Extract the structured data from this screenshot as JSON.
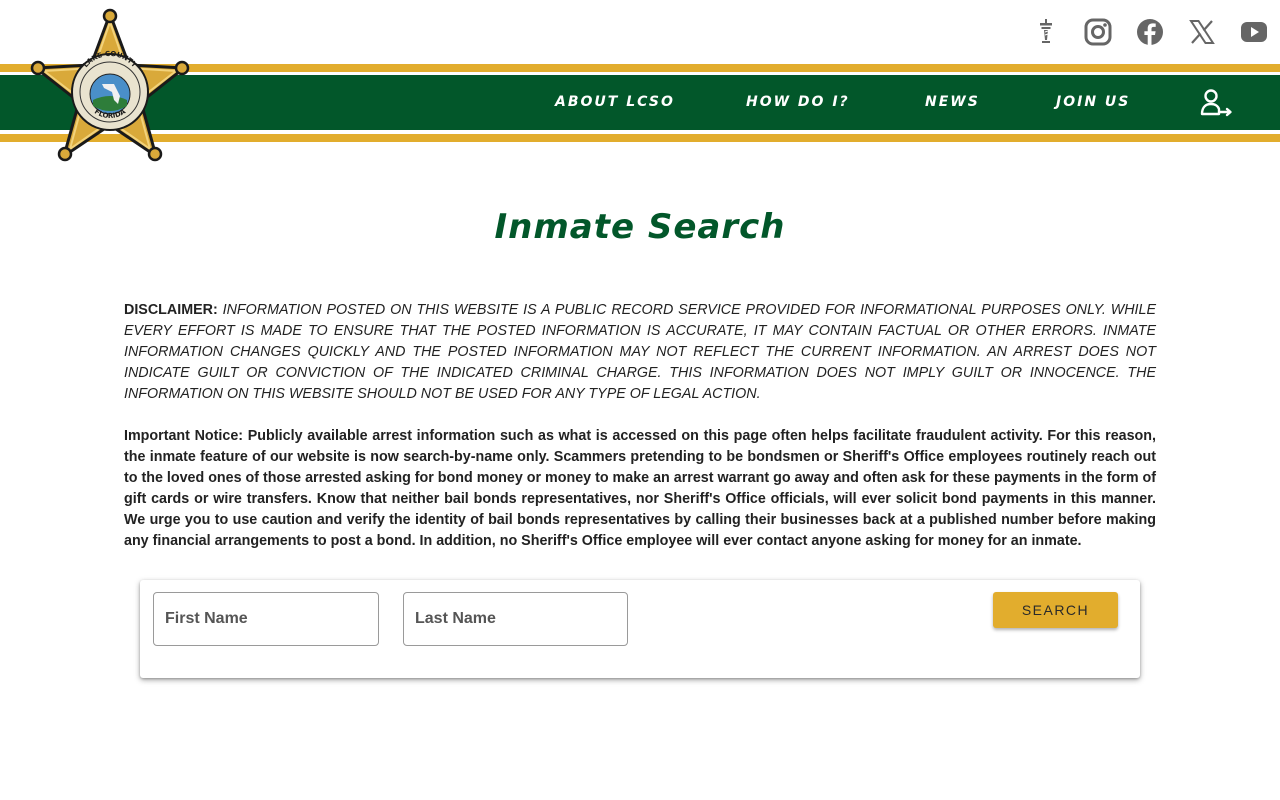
{
  "header": {
    "social": [
      {
        "name": "lighthouse-icon"
      },
      {
        "name": "instagram-icon"
      },
      {
        "name": "facebook-icon"
      },
      {
        "name": "x-twitter-icon"
      },
      {
        "name": "youtube-icon"
      }
    ],
    "nav": [
      {
        "label": "ABOUT LCSO"
      },
      {
        "label": "HOW DO I?"
      },
      {
        "label": "NEWS"
      },
      {
        "label": "JOIN US"
      }
    ],
    "badge": {
      "top_text": "OFFICE OF THE SHERIFF",
      "middle_text": "LAKE COUNTY",
      "bottom_text": "FLORIDA"
    }
  },
  "colors": {
    "green": "#02572a",
    "gold": "#e2ad2d"
  },
  "main": {
    "title": "Inmate Search",
    "disclaimer_label": "DISCLAIMER:",
    "disclaimer_text": "INFORMATION POSTED ON THIS WEBSITE IS A PUBLIC RECORD SERVICE PROVIDED FOR INFORMATIONAL PURPOSES ONLY. WHILE EVERY EFFORT IS MADE TO ENSURE THAT THE POSTED INFORMATION IS ACCURATE, IT MAY CONTAIN FACTUAL OR OTHER ERRORS. INMATE INFORMATION CHANGES QUICKLY AND THE POSTED INFORMATION MAY NOT REFLECT THE CURRENT INFORMATION. AN ARREST DOES NOT INDICATE GUILT OR CONVICTION OF THE INDICATED CRIMINAL CHARGE. THIS INFORMATION DOES NOT IMPLY GUILT OR INNOCENCE. THE INFORMATION ON THIS WEBSITE SHOULD NOT BE USED FOR ANY TYPE OF LEGAL ACTION.",
    "notice_text": "Important Notice: Publicly available arrest information such as what is accessed on this page often helps facilitate fraudulent activity. For this reason, the inmate feature of our website is now search-by-name only. Scammers pretending to be bondsmen or Sheriff's Office employees routinely reach out to the loved ones of those arrested asking for bond money or money to make an arrest warrant go away and often ask for these payments in the form of gift cards or wire transfers. Know that neither bail bonds representatives, nor Sheriff's Office officials, will ever solicit bond payments in this manner. We urge you to use caution and verify the identity of bail bonds representatives by calling their businesses back at a published number before making any financial arrangements to post a bond. In addition, no Sheriff's Office employee will ever contact anyone asking for money for an inmate."
  },
  "search": {
    "first_name_placeholder": "First Name",
    "first_name_value": "",
    "last_name_placeholder": "Last Name",
    "last_name_value": "",
    "button_label": "SEARCH"
  }
}
